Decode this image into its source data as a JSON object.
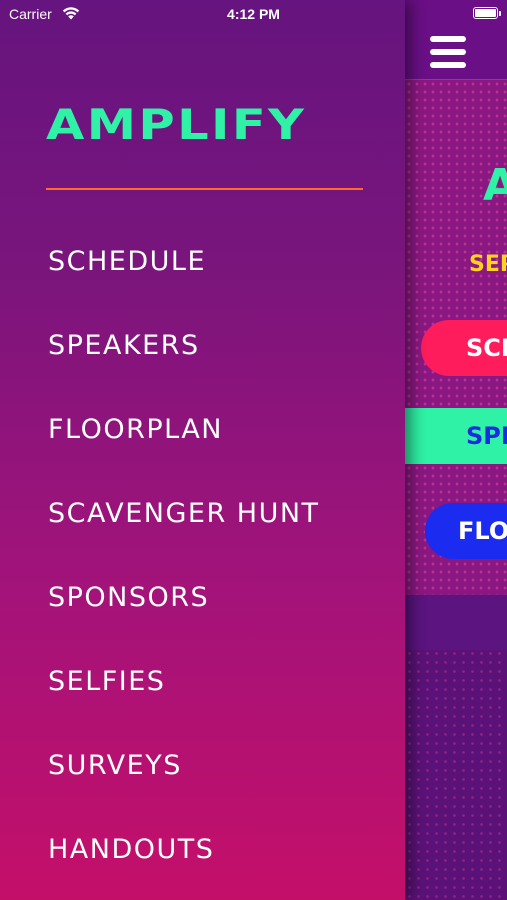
{
  "status_bar": {
    "carrier": "Carrier",
    "time": "4:12 PM",
    "wifi_icon": "wifi-icon",
    "battery_icon": "battery-icon"
  },
  "drawer": {
    "logo": "AMPLIFY",
    "menu": [
      {
        "label": "SCHEDULE"
      },
      {
        "label": "SPEAKERS"
      },
      {
        "label": "FLOORPLAN"
      },
      {
        "label": "SCAVENGER HUNT"
      },
      {
        "label": "SPONSORS"
      },
      {
        "label": "SELFIES"
      },
      {
        "label": "SURVEYS"
      },
      {
        "label": "HANDOUTS"
      }
    ]
  },
  "main_screen": {
    "menu_icon": "hamburger-icon",
    "logo_fragment": "A",
    "subtitle_fragment": "SEP",
    "buttons": [
      {
        "label": "SCH"
      },
      {
        "label": "SPE"
      },
      {
        "label": "FLO"
      }
    ]
  },
  "colors": {
    "accent_green": "#2ff2a6",
    "divider_orange": "#ff6b2e",
    "pink": "#ff1c5c",
    "blue": "#1c2bf0",
    "yellow": "#ffd21f"
  }
}
